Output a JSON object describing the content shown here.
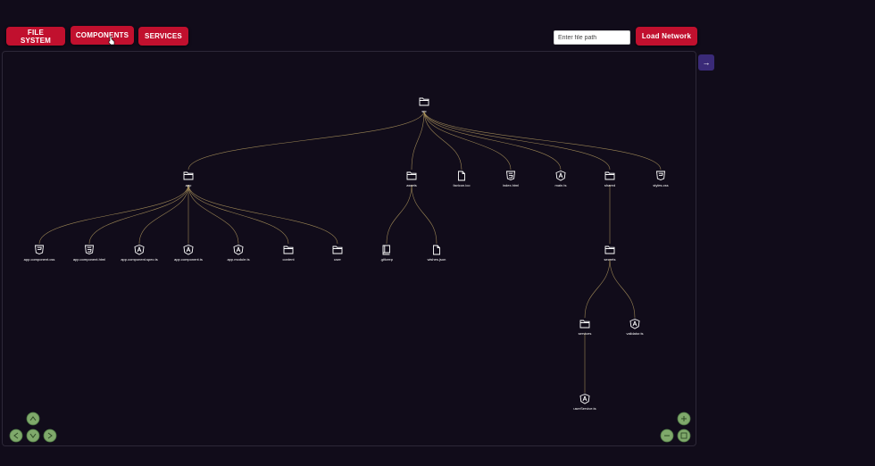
{
  "tabs": [
    {
      "id": "file-system",
      "label": "FILE SYSTEM"
    },
    {
      "id": "components",
      "label": "COMPONENTS"
    },
    {
      "id": "services",
      "label": "SERVICES"
    }
  ],
  "path_input": {
    "placeholder": "Enter file path"
  },
  "load_button": {
    "label": "Load Network"
  },
  "panel_toggle": {
    "label": "→"
  },
  "colors": {
    "background": "#110c1a",
    "button": "#c1102e",
    "edge": "#b39a5f",
    "nav": "#7fa96b",
    "toggle": "#3a2a78"
  },
  "nodes": {
    "src": {
      "label": "src",
      "icon": "folder-icon"
    },
    "app": {
      "label": "app",
      "icon": "folder-icon"
    },
    "assets": {
      "label": "assets",
      "icon": "folder-icon"
    },
    "favicon": {
      "label": "favicon.ico",
      "icon": "file-icon"
    },
    "index": {
      "label": "index.html",
      "icon": "html5-icon"
    },
    "main": {
      "label": "main.ts",
      "icon": "angular-icon"
    },
    "shared": {
      "label": "shared",
      "icon": "folder-icon"
    },
    "styles": {
      "label": "styles.css",
      "icon": "css3-icon"
    },
    "app_css": {
      "label": "app.component.css",
      "icon": "css3-icon"
    },
    "app_html": {
      "label": "app.component.html",
      "icon": "html5-icon"
    },
    "app_spec": {
      "label": "app.component.spec.ts",
      "icon": "angular-icon"
    },
    "app_ts": {
      "label": "app.component.ts",
      "icon": "angular-icon"
    },
    "app_module": {
      "label": "app.module.ts",
      "icon": "angular-icon"
    },
    "content": {
      "label": "content",
      "icon": "folder-icon"
    },
    "user": {
      "label": "user",
      "icon": "folder-icon"
    },
    "gitkeep": {
      "label": ".gitkeep",
      "icon": "book-icon"
    },
    "wishes": {
      "label": "wishes.json",
      "icon": "file-icon"
    },
    "secrets": {
      "label": "secrets",
      "icon": "folder-icon"
    },
    "services": {
      "label": "services",
      "icon": "folder-icon"
    },
    "validate": {
      "label": "validator.ts",
      "icon": "angular-icon"
    },
    "svc": {
      "label": "userService.ts",
      "icon": "angular-icon"
    }
  },
  "edges": [
    [
      "src",
      "app"
    ],
    [
      "src",
      "assets"
    ],
    [
      "src",
      "favicon"
    ],
    [
      "src",
      "index"
    ],
    [
      "src",
      "main"
    ],
    [
      "src",
      "shared"
    ],
    [
      "src",
      "styles"
    ],
    [
      "app",
      "app_css"
    ],
    [
      "app",
      "app_html"
    ],
    [
      "app",
      "app_spec"
    ],
    [
      "app",
      "app_ts"
    ],
    [
      "app",
      "app_module"
    ],
    [
      "app",
      "content"
    ],
    [
      "app",
      "user"
    ],
    [
      "assets",
      "gitkeep"
    ],
    [
      "assets",
      "wishes"
    ],
    [
      "shared",
      "secrets"
    ],
    [
      "secrets",
      "services"
    ],
    [
      "secrets",
      "validate"
    ],
    [
      "services",
      "svc"
    ]
  ]
}
